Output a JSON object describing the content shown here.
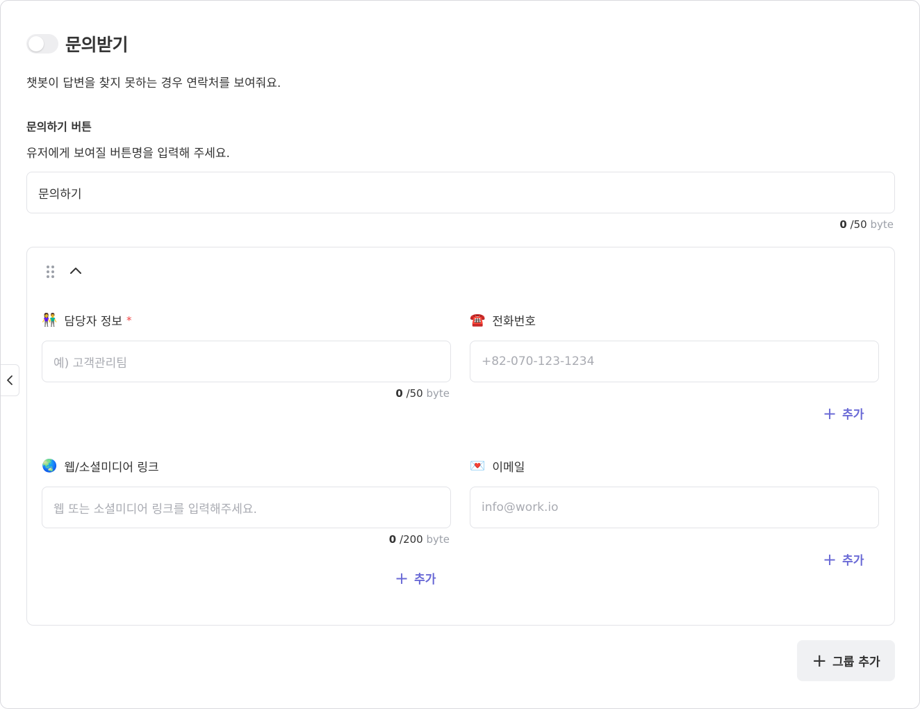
{
  "header": {
    "title": "문의받기",
    "toggle_on": false
  },
  "description": "챗봇이 답변을 찾지 못하는 경우 연락처를 보여줘요.",
  "button_section": {
    "label": "문의하기 버튼",
    "description": "유저에게 보여질 버튼명을 입력해 주세요.",
    "input_value": "문의하기",
    "counter": {
      "count": "0",
      "max": "/50",
      "unit": "byte"
    }
  },
  "group": {
    "manager": {
      "emoji": "👫",
      "label": "담당자 정보",
      "required_mark": "*",
      "placeholder": "예) 고객관리팀",
      "counter": {
        "count": "0",
        "max": "/50",
        "unit": "byte"
      }
    },
    "phone": {
      "emoji": "☎️",
      "label": "전화번호",
      "placeholder": "+82-070-123-1234",
      "add_label": "추가"
    },
    "web": {
      "emoji": "🌏",
      "label": "웹/소셜미디어 링크",
      "placeholder": "웹 또는 소셜미디어 링크를 입력해주세요.",
      "counter": {
        "count": "0",
        "max": "/200",
        "unit": "byte"
      },
      "add_label": "추가"
    },
    "email": {
      "emoji": "💌",
      "label": "이메일",
      "placeholder": "info@work.io",
      "add_label": "추가"
    }
  },
  "group_add_label": "그룹 추가",
  "colors": {
    "accent": "#6a6ad6",
    "required": "#ef4444",
    "border": "#e2e3e7"
  }
}
